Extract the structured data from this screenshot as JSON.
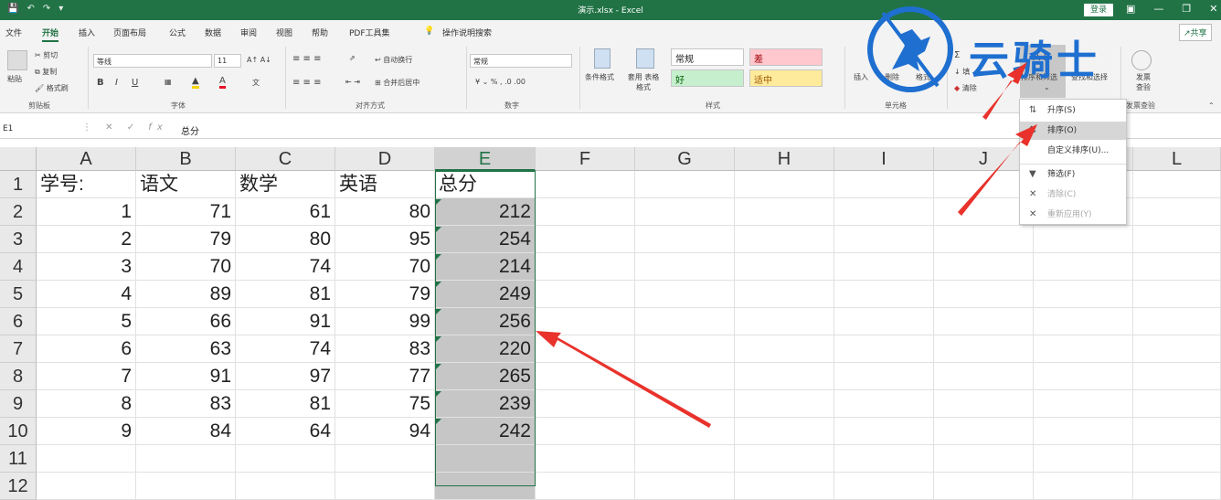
{
  "window": {
    "title": "演示.xlsx  -  Excel",
    "login": "登录"
  },
  "menu": [
    "文件",
    "开始",
    "插入",
    "页面布局",
    "公式",
    "数据",
    "审阅",
    "视图",
    "帮助",
    "PDF工具集",
    "操作说明搜索"
  ],
  "share": "共享",
  "ribbon": {
    "cut": "剪切",
    "copy": "复制",
    "paste": "粘贴",
    "painter": "格式刷",
    "font_name": "等线",
    "font_size": "11",
    "wrap": "自动换行",
    "merge": "合并后居中",
    "number_format": "常规",
    "cond_format": "条件格式",
    "table_format": "套用 表格格式",
    "style_normal": "常规",
    "style_bad": "差",
    "style_good": "好",
    "style_neutral": "适中",
    "insert": "插入",
    "delete": "删除",
    "format": "格式",
    "fill": "填",
    "clear": "清除",
    "sort_filter": "排序和筛选",
    "find_select": "查找和选择",
    "invoice": "发票 查验",
    "groups": {
      "clipboard": "剪贴板",
      "font": "字体",
      "align": "对齐方式",
      "number": "数字",
      "styles": "样式",
      "cells": "单元格",
      "invoice": "发票查验"
    }
  },
  "formula_bar": {
    "name_box": "E1",
    "formula": "总分"
  },
  "grid": {
    "columns": [
      "A",
      "B",
      "C",
      "D",
      "E",
      "F",
      "G",
      "H",
      "I",
      "J",
      "K",
      "L"
    ],
    "header_row": [
      "学号:",
      "语文",
      "数学",
      "英语",
      "总分"
    ],
    "rows": [
      [
        "1",
        "71",
        "61",
        "80",
        "212"
      ],
      [
        "2",
        "79",
        "80",
        "95",
        "254"
      ],
      [
        "3",
        "70",
        "74",
        "70",
        "214"
      ],
      [
        "4",
        "89",
        "81",
        "79",
        "249"
      ],
      [
        "5",
        "66",
        "91",
        "99",
        "256"
      ],
      [
        "6",
        "63",
        "74",
        "83",
        "220"
      ],
      [
        "7",
        "91",
        "97",
        "77",
        "265"
      ],
      [
        "8",
        "83",
        "81",
        "75",
        "239"
      ],
      [
        "9",
        "84",
        "64",
        "94",
        "242"
      ]
    ],
    "row_numbers": [
      "1",
      "2",
      "3",
      "4",
      "5",
      "6",
      "7",
      "8",
      "9",
      "10",
      "11",
      "12"
    ]
  },
  "sort_menu": {
    "items": [
      {
        "label": "升序(S)",
        "icon": "sort-ascending-icon"
      },
      {
        "label": "排序(O)",
        "icon": "sort-icon"
      },
      {
        "label": "自定义排序(U)...",
        "icon": ""
      },
      {
        "label": "筛选(F)",
        "icon": "filter-icon"
      },
      {
        "label": "清除(C)",
        "icon": "clear-filter-icon"
      },
      {
        "label": "重新应用(Y)",
        "icon": "reapply-icon"
      }
    ]
  },
  "watermark": {
    "text": "云骑士",
    "color": "#1e6fd0"
  },
  "colors": {
    "excel_green": "#217346",
    "arrow_red": "#e8322b"
  }
}
